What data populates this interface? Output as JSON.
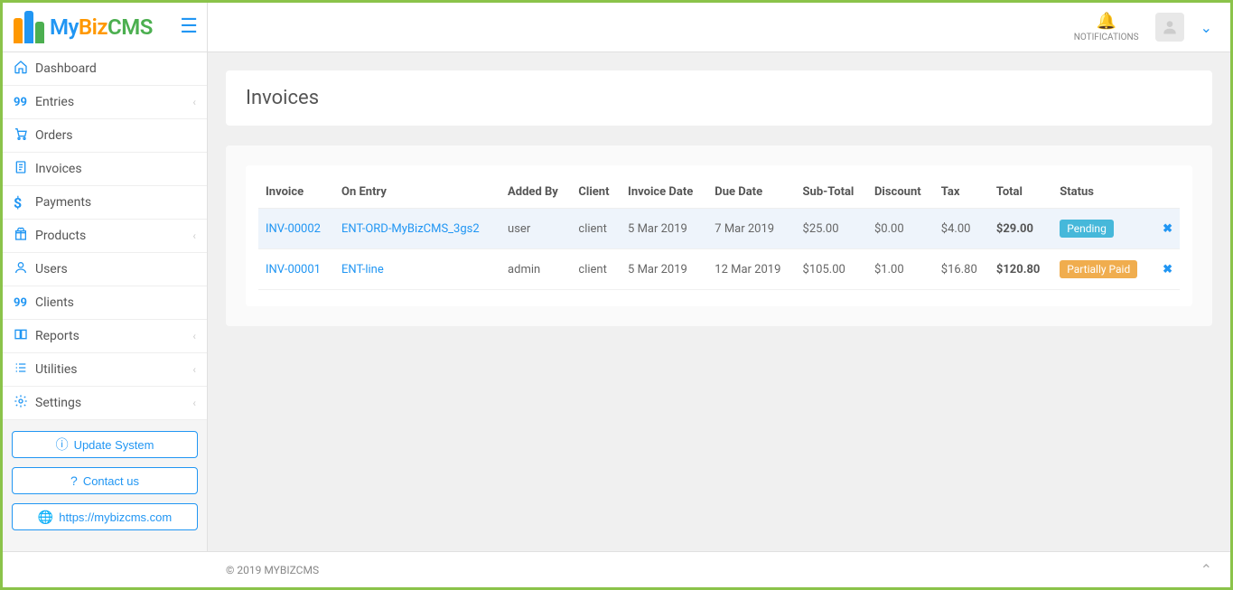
{
  "brand": {
    "my": "My",
    "biz": "Biz",
    "cms": "CMS"
  },
  "header": {
    "notifications_label": "NOTIFICATIONS"
  },
  "sidebar": {
    "items": [
      {
        "label": "Dashboard",
        "icon": "home",
        "expandable": false
      },
      {
        "label": "Entries",
        "icon": "99",
        "expandable": true
      },
      {
        "label": "Orders",
        "icon": "cart",
        "expandable": false
      },
      {
        "label": "Invoices",
        "icon": "invoice",
        "expandable": false
      },
      {
        "label": "Payments",
        "icon": "dollar",
        "expandable": false
      },
      {
        "label": "Products",
        "icon": "gift",
        "expandable": true
      },
      {
        "label": "Users",
        "icon": "user",
        "expandable": false
      },
      {
        "label": "Clients",
        "icon": "99",
        "expandable": false
      },
      {
        "label": "Reports",
        "icon": "book",
        "expandable": true
      },
      {
        "label": "Utilities",
        "icon": "list",
        "expandable": true
      },
      {
        "label": "Settings",
        "icon": "gear",
        "expandable": true
      }
    ],
    "buttons": {
      "update": "Update System",
      "contact": "Contact us",
      "site": "https://mybizcms.com"
    }
  },
  "page": {
    "title": "Invoices"
  },
  "table": {
    "headers": [
      "Invoice",
      "On Entry",
      "Added By",
      "Client",
      "Invoice Date",
      "Due Date",
      "Sub-Total",
      "Discount",
      "Tax",
      "Total",
      "Status",
      ""
    ],
    "rows": [
      {
        "invoice": "INV-00002",
        "entry": "ENT-ORD-MyBizCMS_3gs2",
        "added_by": "user",
        "client": "client",
        "invoice_date": "5 Mar 2019",
        "due_date": "7 Mar 2019",
        "subtotal": "$25.00",
        "discount": "$0.00",
        "tax": "$4.00",
        "total": "$29.00",
        "status": "Pending",
        "status_class": "badge-pending",
        "highlight": true
      },
      {
        "invoice": "INV-00001",
        "entry": "ENT-line",
        "added_by": "admin",
        "client": "client",
        "invoice_date": "5 Mar 2019",
        "due_date": "12 Mar 2019",
        "subtotal": "$105.00",
        "discount": "$1.00",
        "tax": "$16.80",
        "total": "$120.80",
        "status": "Partially Paid",
        "status_class": "badge-partial",
        "highlight": false
      }
    ]
  },
  "footer": {
    "copyright": "© 2019 MYBIZCMS"
  }
}
